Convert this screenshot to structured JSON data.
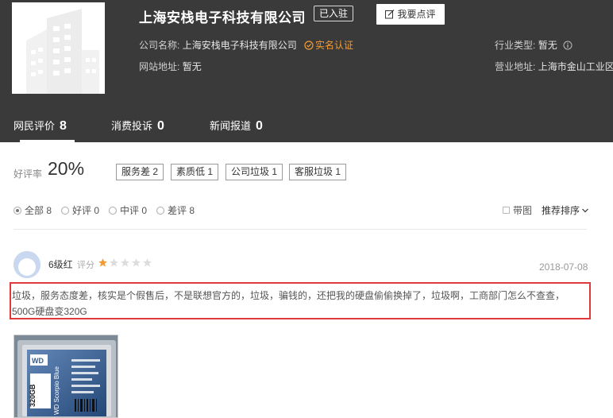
{
  "company": {
    "name": "上海安栈电子科技有限公司",
    "badge": "已入驻",
    "review_button": "我要点评",
    "name_label": "公司名称:",
    "name_value": "上海安栈电子科技有限公司",
    "verified": "实名认证",
    "website_label": "网站地址:",
    "website_value": "暂无",
    "industry_label": "行业类型:",
    "industry_value": "暂无",
    "address_label": "营业地址:",
    "address_value": "上海市金山工业区"
  },
  "tabs": [
    {
      "label": "网民评价",
      "count": "8"
    },
    {
      "label": "消费投诉",
      "count": "0"
    },
    {
      "label": "新闻报道",
      "count": "0"
    }
  ],
  "rating": {
    "label": "好评率",
    "value": "20%"
  },
  "tags": [
    "服务差 2",
    "素质低 1",
    "公司垃圾 1",
    "客服垃圾 1"
  ],
  "filters": [
    {
      "label": "全部 8",
      "selected": true
    },
    {
      "label": "好评 0",
      "selected": false
    },
    {
      "label": "中评 0",
      "selected": false
    },
    {
      "label": "差评 8",
      "selected": false
    }
  ],
  "options": {
    "with_image": "带图",
    "sort": "推荐排序"
  },
  "review": {
    "username": "6级红",
    "score_label": "评分",
    "stars": 1,
    "stars_total": 5,
    "date": "2018-07-08",
    "text": "垃圾，服务态度差，核实是个假售后，不是联想官方的，垃圾，骗钱的，还把我的硬盘偷偷换掉了，垃圾啊，工商部门怎么不查查，500G硬盘变320G",
    "photo_texts": {
      "brand": "WD",
      "capacity": "320GB",
      "model": "WD Scorpio Blue"
    }
  },
  "colors": {
    "header_bg": "#3a3a3a",
    "accent_orange": "#f39c34",
    "highlight_red": "#e0393b"
  }
}
